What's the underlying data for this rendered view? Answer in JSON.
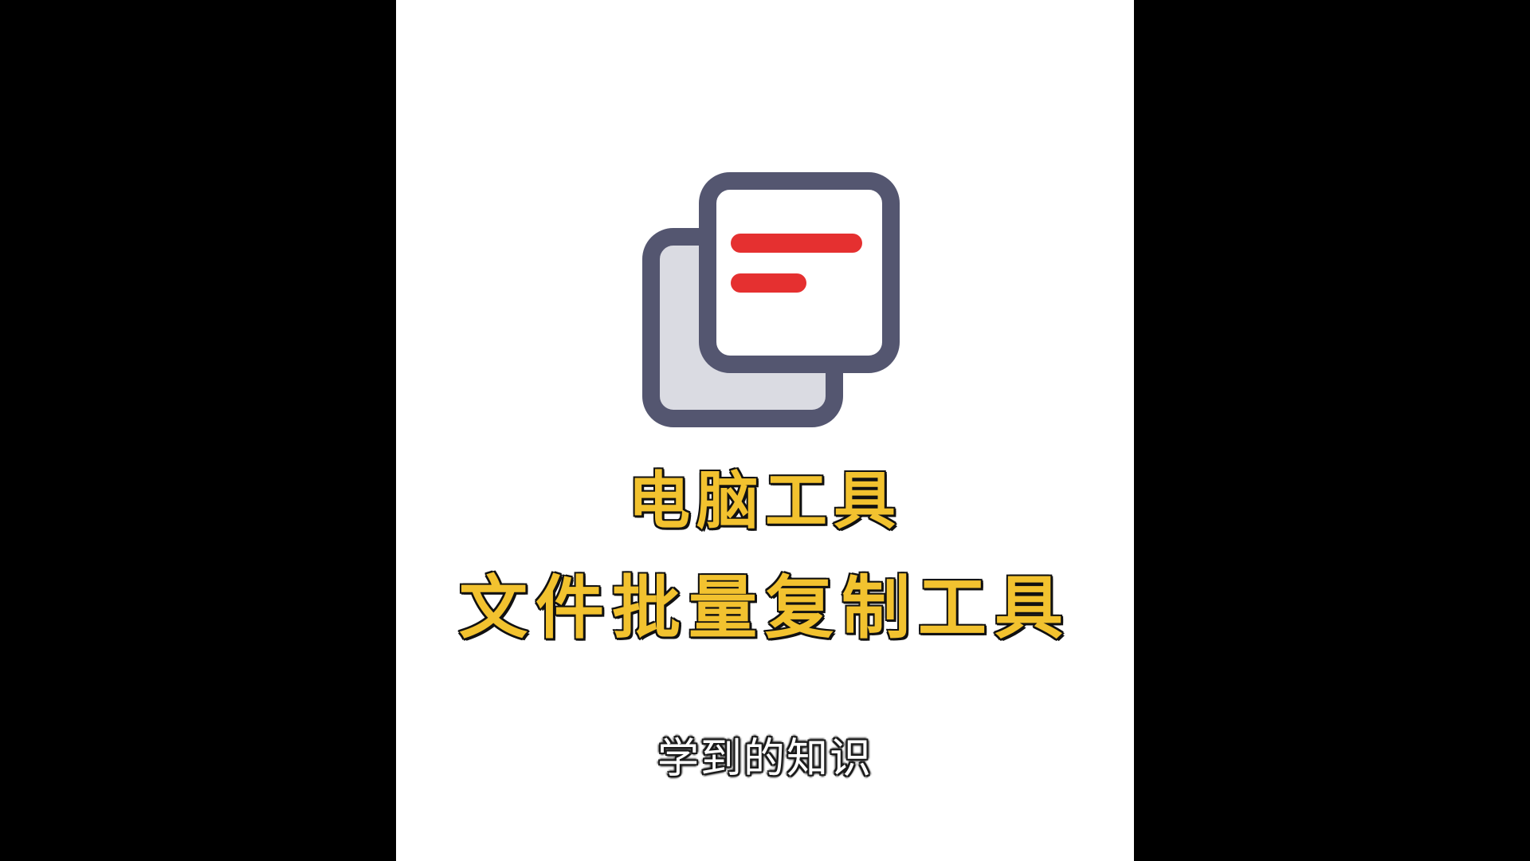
{
  "video": {
    "icon": "copy-files-icon",
    "title_line1": "电脑工具",
    "title_line2": "文件批量复制工具",
    "subtitle": "学到的知识"
  },
  "colors": {
    "background_side": "#000000",
    "panel": "#ffffff",
    "icon_outline": "#545670",
    "icon_back_fill": "#dadbe2",
    "icon_front_fill": "#ffffff",
    "icon_lines": "#e53030",
    "title_fill": "#f2c22f",
    "title_outline": "#111111",
    "subtitle_fill": "#ffffff"
  }
}
